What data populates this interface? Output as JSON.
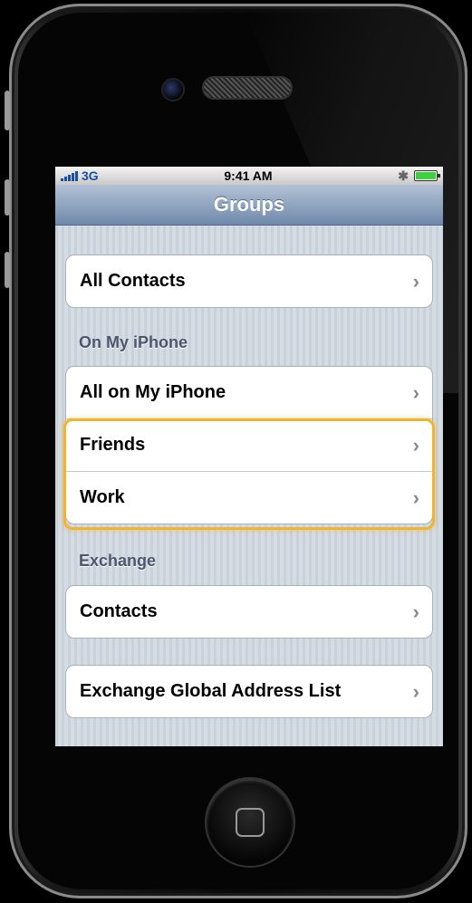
{
  "status": {
    "carrier": "3G",
    "time": "9:41 AM"
  },
  "nav": {
    "title": "Groups"
  },
  "groups": {
    "all_contacts": "All Contacts",
    "on_my_iphone_header": "On My iPhone",
    "all_on_my_iphone": "All on My iPhone",
    "friends": "Friends",
    "work": "Work",
    "exchange_header": "Exchange",
    "contacts": "Contacts",
    "exchange_gal": "Exchange Global Address List"
  },
  "chevron": "›",
  "colors": {
    "highlight": "#f1b42f",
    "nav_bar": "#6f89ab",
    "battery": "#3dd23d"
  },
  "icons": [
    "signal-icon",
    "bluetooth-icon",
    "battery-icon",
    "chevron-right-icon",
    "home-button-icon"
  ]
}
